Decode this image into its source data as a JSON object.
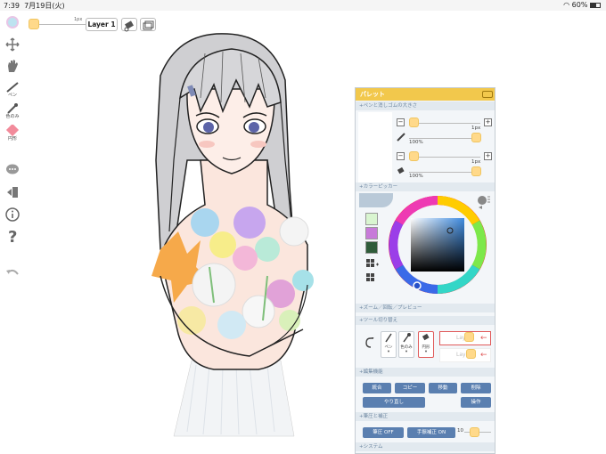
{
  "status_bar": {
    "time": "7:39",
    "date": "7月19日(火)",
    "battery": "60%"
  },
  "toolbar": {
    "pen_label": "ペン",
    "eyedropper_label": "色のみ",
    "shape_label": "円形"
  },
  "topbar": {
    "size_value": "1px",
    "layer_label": "Layer 1"
  },
  "palette": {
    "title": "パレット",
    "section_size": "+ペンと消しゴムの大きさ",
    "pen_size": "1px",
    "pen_opacity": "100%",
    "eraser_size": "1px",
    "eraser_opacity": "100%",
    "section_color": "+カラーピッカー",
    "swatch_colors": [
      "#d9f5d0",
      "#c77ad9",
      "#2f5c3a"
    ],
    "section_zoom": "+ズーム／回転／プレビュー",
    "section_tools": "+ツール切り替え",
    "tool_pen": "ペン",
    "tool_color_only": "色のみ",
    "tool_circle": "円形",
    "layer1": "Layer1",
    "layer2": "Layer2",
    "section_edit": "+編集機能",
    "merge": "統合",
    "copy": "コピー",
    "move": "移動",
    "delete": "削除",
    "redo": "やり直し",
    "operate": "操作",
    "section_pressure": "+筆圧と補正",
    "pressure_btn": "筆圧 OFF",
    "stabilizer_btn": "手振補正 ON",
    "stabilizer_value": "10",
    "section_system": "+システム"
  }
}
